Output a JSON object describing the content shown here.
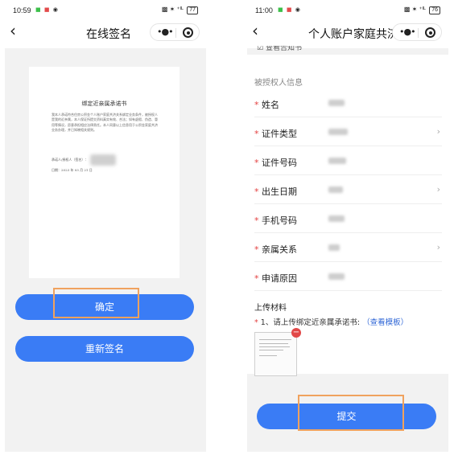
{
  "left": {
    "status": {
      "time": "10:59",
      "signal": "▩ ✶ ⁺ᴵᴸ ",
      "battery": "77"
    },
    "nav": {
      "back": "‹",
      "title": "在线签名"
    },
    "document": {
      "title": "绑定近亲属承诺书",
      "body": "    我本人承诺符合住房公积金个人账户家庭共济关系绑定业务条件，被授权人是我的近亲属，本人保证所提交资料真实有效、合法；如有虚假、伪造、冒用等情况，愿意承担相应法律责任。本人同意以上信息用于公积金家庭共济业务办理，并已知晓相关规则。",
      "sign_label": "承诺人/授权人（签名）：",
      "date_label": "日期：2023 年 03 月 21 日"
    },
    "buttons": {
      "confirm": "确定",
      "resign": "重新签名"
    }
  },
  "right": {
    "status": {
      "time": "11:00",
      "signal": "▩ ✶ ⁺ᴵᴸ ",
      "battery": "76"
    },
    "nav": {
      "back": "‹",
      "title": "个人账户家庭共济..."
    },
    "peek_text": "查看告知书",
    "section_label": "被授权人信息",
    "rows": [
      {
        "label": "姓名",
        "has_chevron": false
      },
      {
        "label": "证件类型",
        "has_chevron": true
      },
      {
        "label": "证件号码",
        "has_chevron": false
      },
      {
        "label": "出生日期",
        "has_chevron": true
      },
      {
        "label": "手机号码",
        "has_chevron": false
      },
      {
        "label": "亲属关系",
        "has_chevron": true
      },
      {
        "label": "申请原因",
        "has_chevron": false
      }
    ],
    "required_mark": "*",
    "chevron": "›",
    "upload": {
      "title": "上传材料",
      "tip": "1、请上传绑定近亲属承诺书:",
      "link": "（查看模板）",
      "delete": "−"
    },
    "buttons": {
      "submit": "提交"
    }
  },
  "colors": {
    "primary": "#3a7cf5",
    "highlight": "#f0a25e",
    "required": "#e34040",
    "link": "#2f66d6"
  },
  "icons": [
    "back-arrow-icon",
    "more-dots-icon",
    "close-target-icon",
    "chevron-right-icon",
    "delete-icon"
  ]
}
